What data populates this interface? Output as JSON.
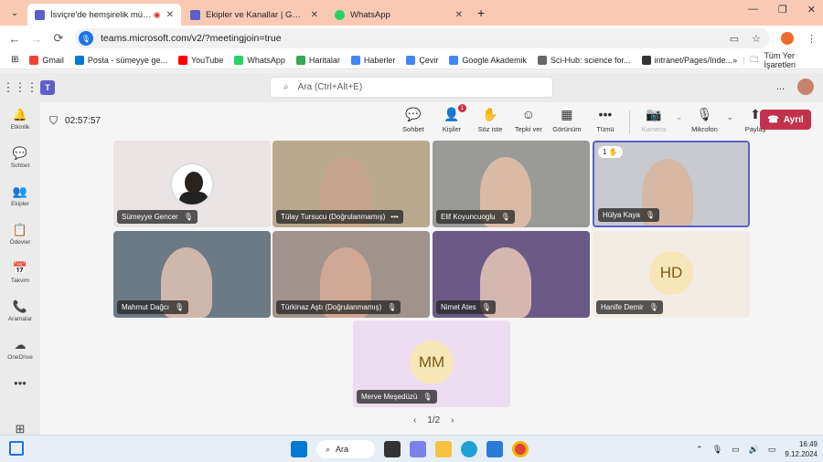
{
  "browser": {
    "tabs": [
      {
        "title": "İsviçre'de hemşirelik müfredat",
        "active": true,
        "fav_color": "#5b5fc7",
        "recording": true
      },
      {
        "title": "Ekipler ve Kanallar | Genel | Mic",
        "active": false,
        "fav_color": "#5b5fc7"
      },
      {
        "title": "WhatsApp",
        "active": false,
        "fav_color": "#25d366"
      }
    ],
    "new_tab": "+",
    "url": "teams.microsoft.com/v2/?meetingjoin=true",
    "bookmarks": [
      {
        "label": "Gmail",
        "color": "#ea4335"
      },
      {
        "label": "Posta - sümeyye ge...",
        "color": "#0078d4"
      },
      {
        "label": "YouTube",
        "color": "#ff0000"
      },
      {
        "label": "WhatsApp",
        "color": "#25d366"
      },
      {
        "label": "Haritalar",
        "color": "#34a853"
      },
      {
        "label": "Haberler",
        "color": "#4285f4"
      },
      {
        "label": "Çevir",
        "color": "#4285f4"
      },
      {
        "label": "Google Akademik",
        "color": "#4285f4"
      },
      {
        "label": "Sci-Hub: science for...",
        "color": "#666666"
      },
      {
        "label": "intranet/Pages/Inde...",
        "color": "#333333"
      }
    ],
    "bookmarks_more": "»",
    "all_bookmarks": "Tüm Yer İşaretleri"
  },
  "teams": {
    "search_placeholder": "Ara (Ctrl+Alt+E)",
    "more": "...",
    "rail": [
      {
        "icon": "bell-icon",
        "glyph": "🔔",
        "label": "Etkinlik"
      },
      {
        "icon": "chat-icon",
        "glyph": "💬",
        "label": "Sohbet"
      },
      {
        "icon": "teams-icon",
        "glyph": "👥",
        "label": "Ekipler"
      },
      {
        "icon": "assignments-icon",
        "glyph": "📋",
        "label": "Ödevler"
      },
      {
        "icon": "calendar-icon",
        "glyph": "📅",
        "label": "Takvim"
      },
      {
        "icon": "calls-icon",
        "glyph": "📞",
        "label": "Aramalar"
      },
      {
        "icon": "onedrive-icon",
        "glyph": "☁",
        "label": "OneDrive"
      },
      {
        "icon": "more-icon",
        "glyph": "•••",
        "label": ""
      },
      {
        "icon": "apps-icon",
        "glyph": "⊞",
        "label": "Uygulamalar"
      }
    ]
  },
  "meeting": {
    "timer": "02:57:57",
    "controls": [
      {
        "icon": "chat-icon",
        "glyph": "💬",
        "label": "Sohbet",
        "disabled": false
      },
      {
        "icon": "people-icon",
        "glyph": "👤",
        "label": "Kişiler",
        "disabled": false,
        "badge": "1"
      },
      {
        "icon": "raise-hand-icon",
        "glyph": "✋",
        "label": "Söz iste",
        "disabled": false
      },
      {
        "icon": "react-icon",
        "glyph": "☺",
        "label": "Tepki ver",
        "disabled": false
      },
      {
        "icon": "view-icon",
        "glyph": "▦",
        "label": "Görünüm",
        "disabled": false
      },
      {
        "icon": "more-icon",
        "glyph": "•••",
        "label": "Tümü",
        "disabled": false
      }
    ],
    "camera": {
      "glyph": "📷",
      "label": "Kamera"
    },
    "mic": {
      "glyph": "🎙",
      "label": "Mikrofon"
    },
    "share": {
      "glyph": "⬆",
      "label": "Paylaş"
    },
    "leave": "Ayrıl",
    "participants": [
      {
        "name": "Sümeyye Gencer",
        "bg": "#eae4e4"
      },
      {
        "name": "Tülay Tursucu (Doğrulanmamış)",
        "bg": "#b9a98f",
        "menu": "•••"
      },
      {
        "name": "Elif Koyuncuoglu",
        "bg": "#9a9a96"
      },
      {
        "name": "Hülya Kaya",
        "bg": "#c7c9ce",
        "hand": "1 ✋"
      },
      {
        "name": "Mahmut Dağcı",
        "bg": "#6c7a86"
      },
      {
        "name": "Türkinaz Aştı (Doğrulanmamış)",
        "bg": "#9f938c"
      },
      {
        "name": "Nimet Ates",
        "bg": "#6b5a88"
      },
      {
        "name": "Hanife Demir",
        "bg": "#f3ece4",
        "initials": "HD"
      },
      {
        "name": "Merve Meşedüzü",
        "bg": "#ecdcef",
        "initials": "MM"
      }
    ],
    "pager": {
      "prev": "‹",
      "text": "1/2",
      "next": "›"
    }
  },
  "taskbar": {
    "search": "Ara",
    "time": "16:49",
    "date": "9.12.2024"
  }
}
